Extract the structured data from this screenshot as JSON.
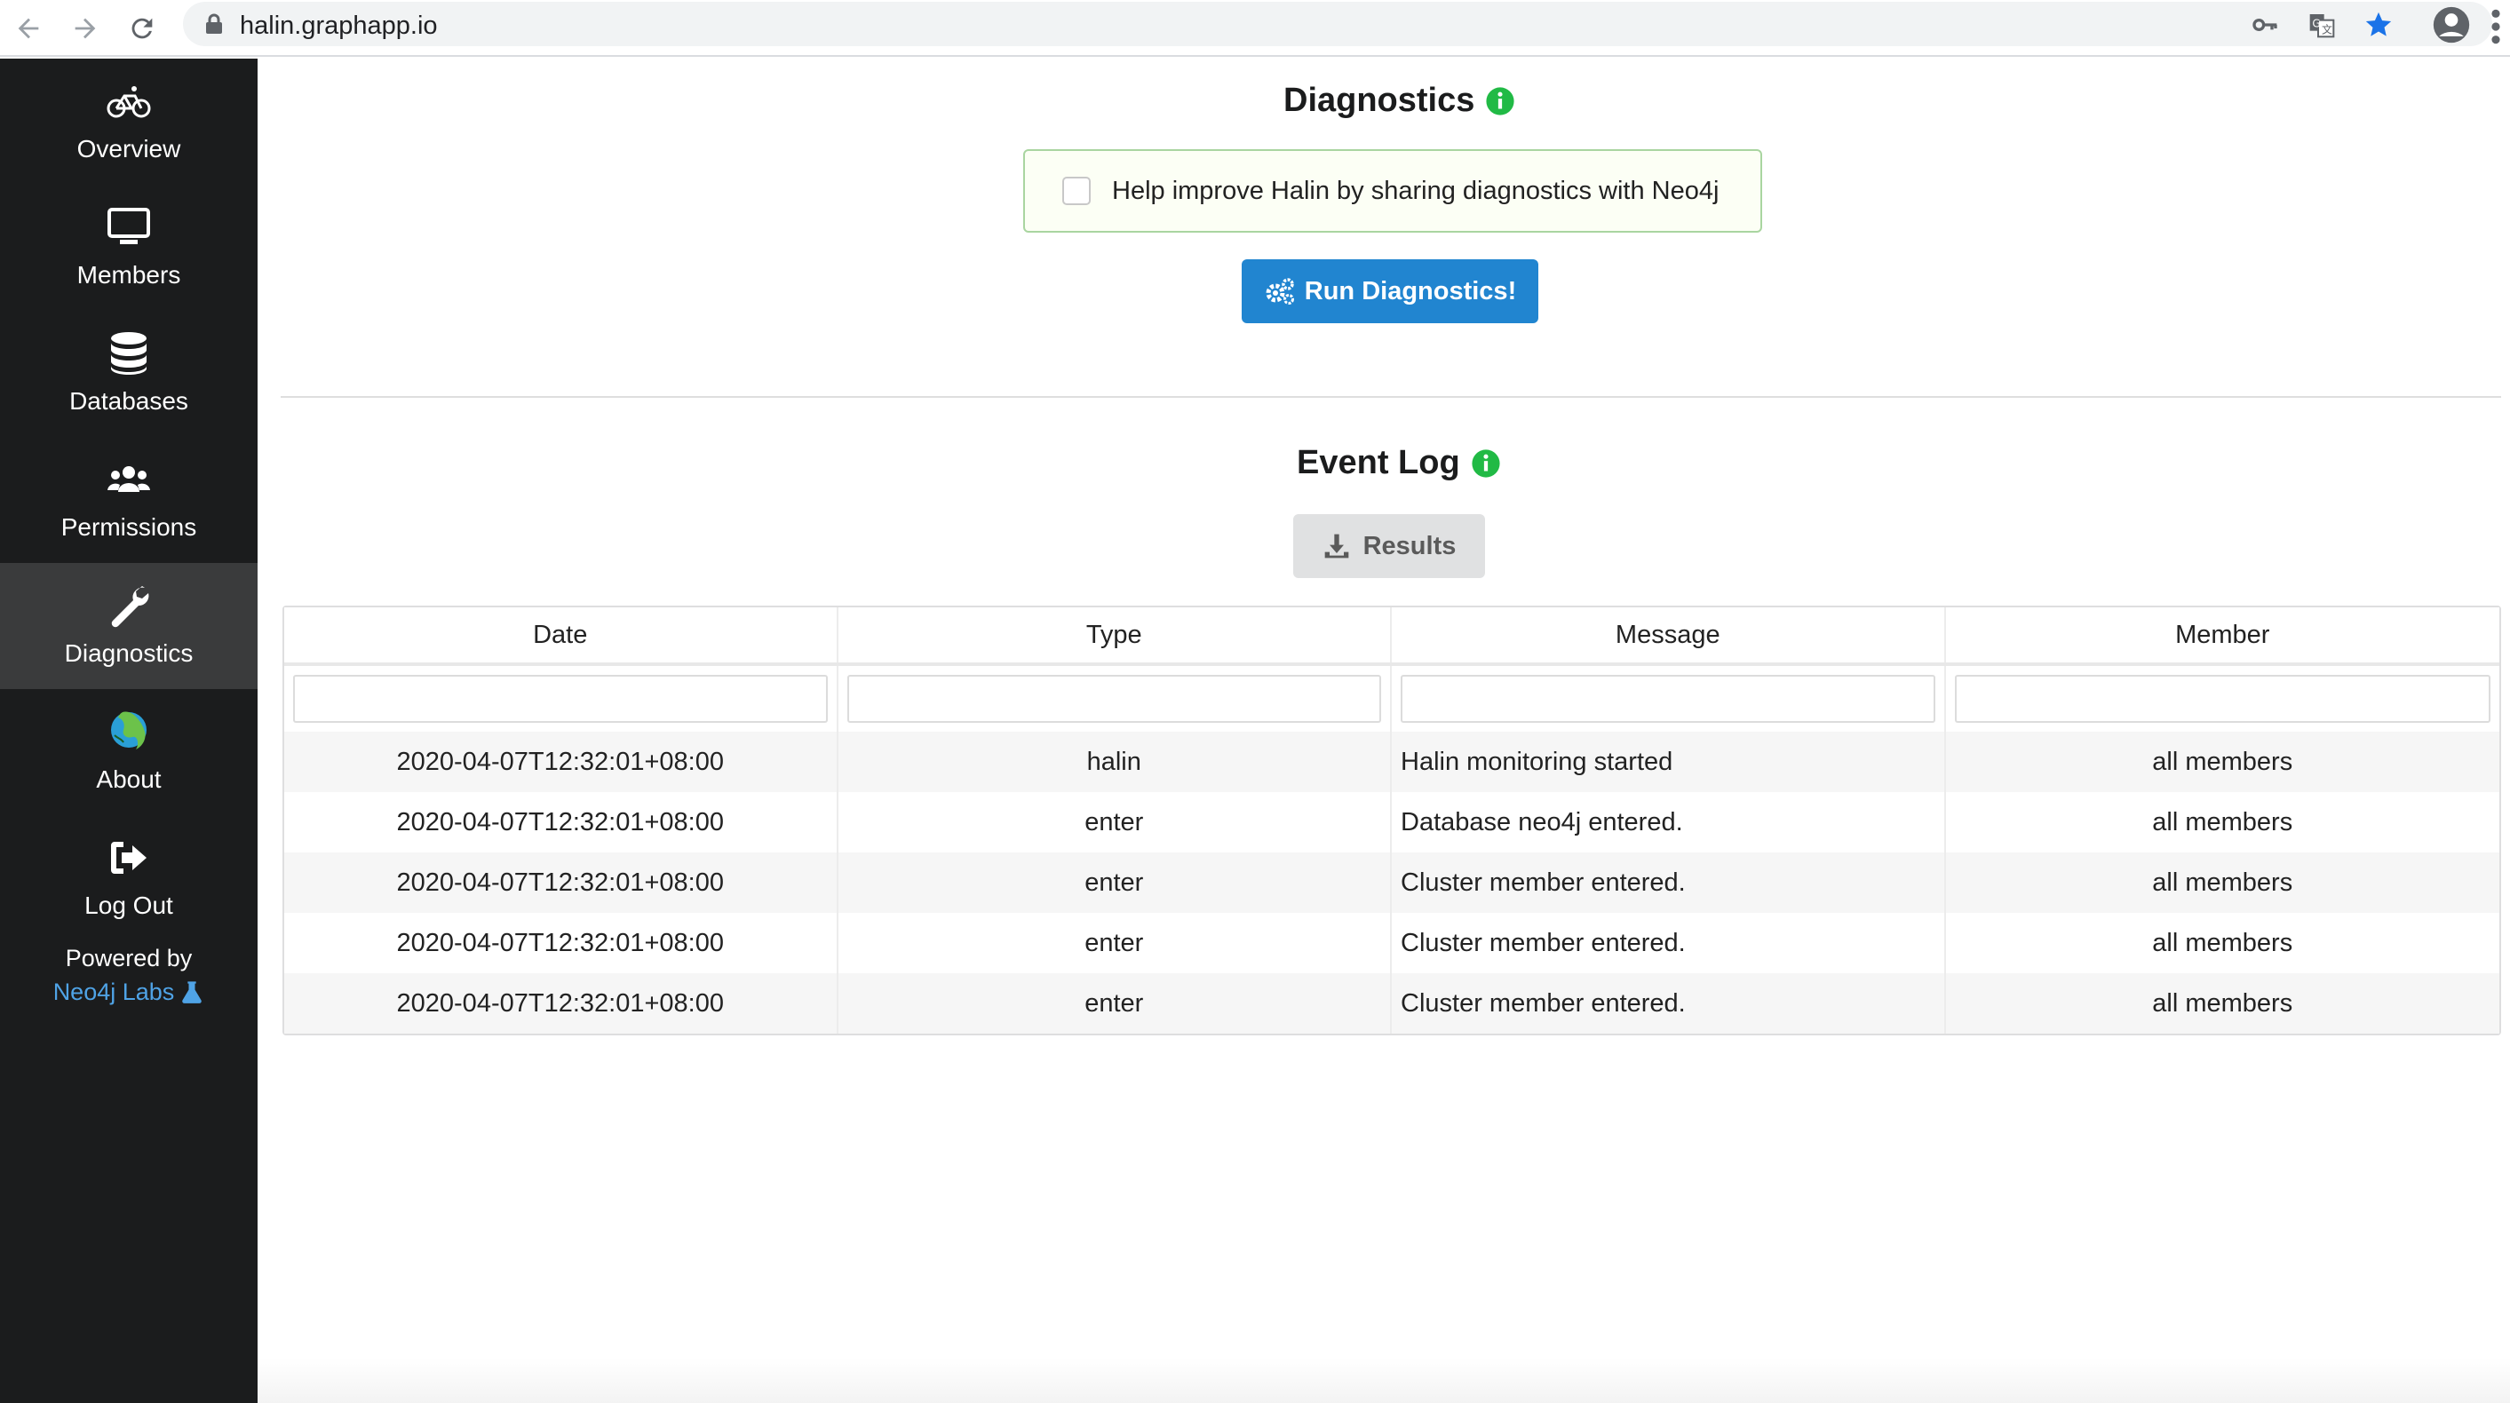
{
  "browser": {
    "url": "halin.graphapp.io"
  },
  "sidebar": {
    "items": [
      {
        "label": "Overview",
        "icon": "bicycle-icon"
      },
      {
        "label": "Members",
        "icon": "monitor-icon"
      },
      {
        "label": "Databases",
        "icon": "database-icon"
      },
      {
        "label": "Permissions",
        "icon": "users-icon"
      },
      {
        "label": "Diagnostics",
        "icon": "wrench-icon"
      },
      {
        "label": "About",
        "icon": "halin-logo-icon"
      },
      {
        "label": "Log Out",
        "icon": "sign-out-icon"
      }
    ],
    "powered_by": "Powered by",
    "powered_link": "Neo4j Labs"
  },
  "diagnostics": {
    "title": "Diagnostics",
    "share_label": "Help improve Halin by sharing diagnostics with Neo4j",
    "run_button": "Run Diagnostics!"
  },
  "event_log": {
    "title": "Event Log",
    "results_button": "Results",
    "columns": [
      "Date",
      "Type",
      "Message",
      "Member"
    ],
    "rows": [
      {
        "date": "2020-04-07T12:32:01+08:00",
        "type": "halin",
        "message": "Halin monitoring started",
        "member": "all members"
      },
      {
        "date": "2020-04-07T12:32:01+08:00",
        "type": "enter",
        "message": "Database neo4j entered.",
        "member": "all members"
      },
      {
        "date": "2020-04-07T12:32:01+08:00",
        "type": "enter",
        "message": "Cluster member entered.",
        "member": "all members"
      },
      {
        "date": "2020-04-07T12:32:01+08:00",
        "type": "enter",
        "message": "Cluster member entered.",
        "member": "all members"
      },
      {
        "date": "2020-04-07T12:32:01+08:00",
        "type": "enter",
        "message": "Cluster member entered.",
        "member": "all members"
      }
    ]
  },
  "colors": {
    "sidebar_bg": "#1b1c1d",
    "sidebar_active": "#3a3b3c",
    "primary_button": "#2185d0",
    "info_green": "#21ba45",
    "link_blue": "#4fa3e6"
  }
}
